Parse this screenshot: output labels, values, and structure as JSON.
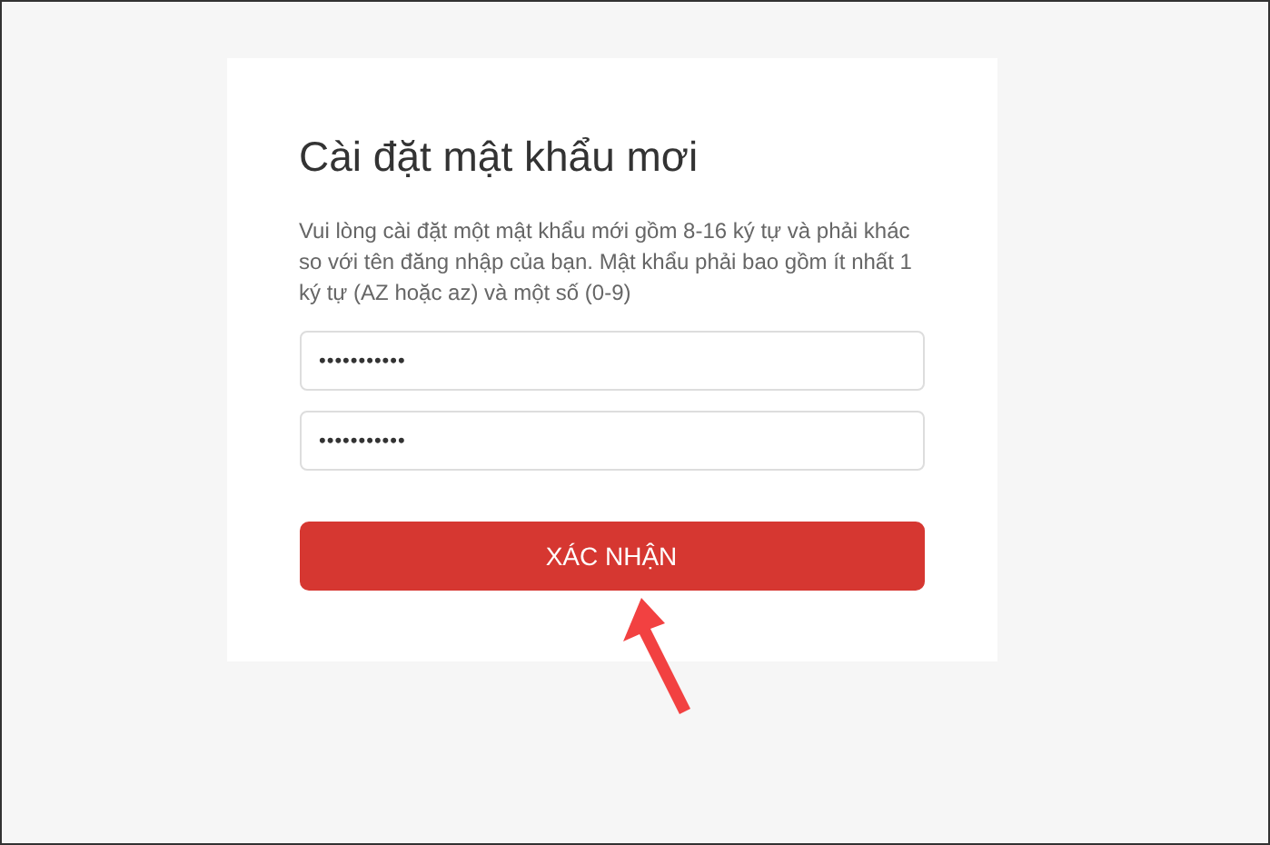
{
  "form": {
    "title": "Cài đặt mật khẩu mơi",
    "instructions": "Vui lòng cài đặt một mật khẩu mới gồm 8-16 ký tự và phải khác so với tên đăng nhập của bạn. Mật khẩu phải bao gồm ít nhất 1 ký tự (AZ hoặc az) và một số (0-9)",
    "fields": [
      {
        "value": "•••••••••••"
      },
      {
        "value": "•••••••••••"
      }
    ],
    "submit": "XÁC NHẬN"
  }
}
